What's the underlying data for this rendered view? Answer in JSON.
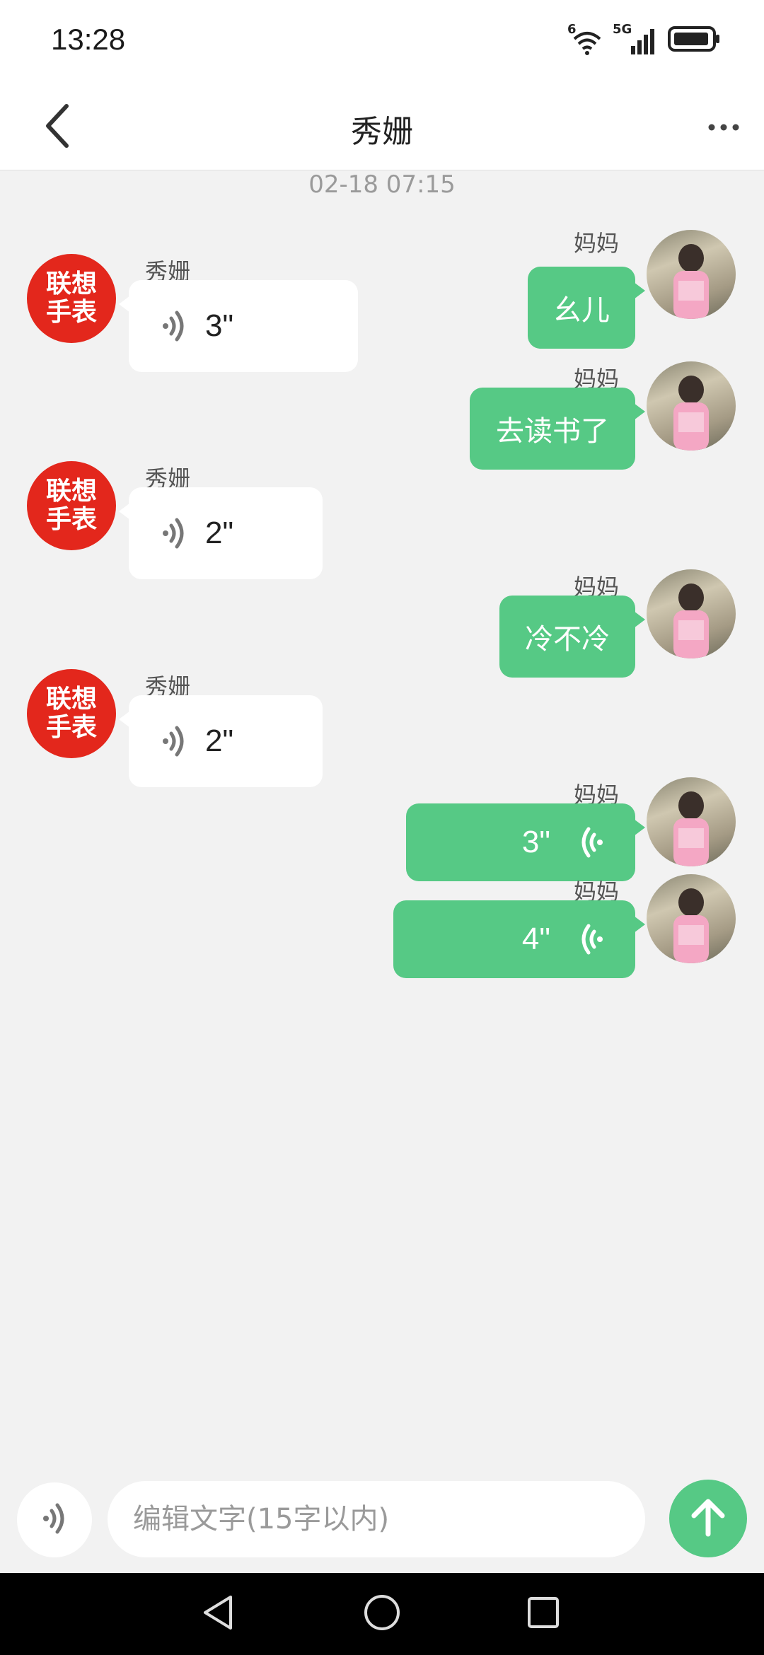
{
  "status_bar": {
    "time": "13:28",
    "network": "5G",
    "wifi_badge": "6"
  },
  "header": {
    "title": "秀姗"
  },
  "chat": {
    "timestamp": "02-18 07:15",
    "messages": [
      {
        "from": "me",
        "name": "妈妈",
        "type": "text",
        "text": "幺儿"
      },
      {
        "from": "watch",
        "name": "秀姗",
        "type": "voice",
        "duration": "3\""
      },
      {
        "from": "me",
        "name": "妈妈",
        "type": "text",
        "text": "去读书了"
      },
      {
        "from": "watch",
        "name": "秀姗",
        "type": "voice",
        "duration": "2\""
      },
      {
        "from": "me",
        "name": "妈妈",
        "type": "text",
        "text": "冷不冷"
      },
      {
        "from": "watch",
        "name": "秀姗",
        "type": "voice",
        "duration": "2\""
      },
      {
        "from": "me",
        "name": "妈妈",
        "type": "voice",
        "duration": "3\""
      },
      {
        "from": "me",
        "name": "妈妈",
        "type": "voice",
        "duration": "4\""
      }
    ],
    "watch_avatar": {
      "line1": "联想",
      "line2": "手表"
    }
  },
  "input": {
    "placeholder": "编辑文字(15字以内)"
  },
  "colors": {
    "accent": "#56c985",
    "avatar_red": "#e3271c",
    "background": "#f2f2f2"
  },
  "icons": [
    "back-arrow-icon",
    "more-dots-icon",
    "voice-wave-icon",
    "send-arrow-icon",
    "wifi-icon",
    "signal-icon",
    "battery-icon",
    "nav-back-icon",
    "nav-home-icon",
    "nav-recents-icon"
  ]
}
